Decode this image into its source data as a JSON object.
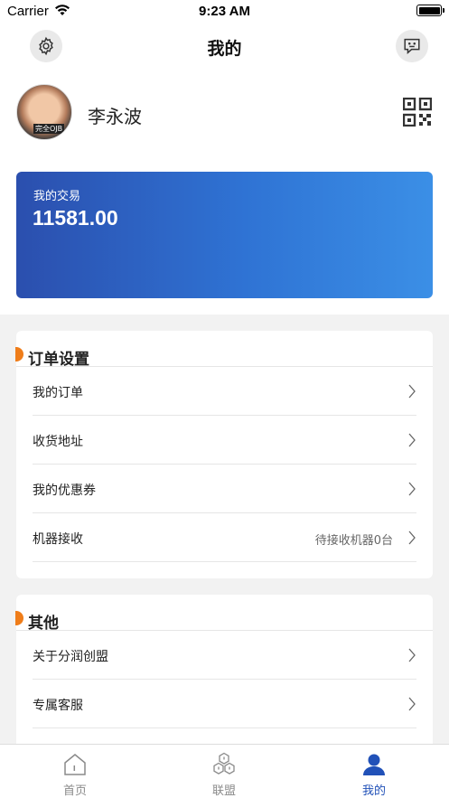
{
  "status_bar": {
    "carrier": "Carrier",
    "time": "9:23 AM",
    "battery_level": 1.0
  },
  "nav": {
    "title": "我的",
    "settings_icon": "gear-icon",
    "message_icon": "chat-icon"
  },
  "profile": {
    "name": "李永波",
    "avatar_caption": "完全OJB",
    "qr_icon": "qr-code-icon"
  },
  "card": {
    "label": "我的交易",
    "value": "11581.00",
    "gradient_start": "#2b4fae",
    "gradient_end": "#3b8fe6"
  },
  "order_section": {
    "title": "订单设置",
    "accent": "#ef7d1a",
    "items": [
      {
        "label": "我的订单",
        "value": ""
      },
      {
        "label": "收货地址",
        "value": ""
      },
      {
        "label": "我的优惠券",
        "value": ""
      },
      {
        "label": "机器接收",
        "value": "待接收机器0台"
      }
    ]
  },
  "other_section": {
    "title": "其他",
    "items": [
      {
        "label": "关于分润创盟",
        "value": ""
      },
      {
        "label": "专属客服",
        "value": ""
      }
    ]
  },
  "tabbar": {
    "active_color": "#2151b8",
    "tabs": [
      {
        "label": "首页",
        "icon": "home-icon"
      },
      {
        "label": "联盟",
        "icon": "hexagon-cluster-icon"
      },
      {
        "label": "我的",
        "icon": "user-icon"
      }
    ]
  }
}
